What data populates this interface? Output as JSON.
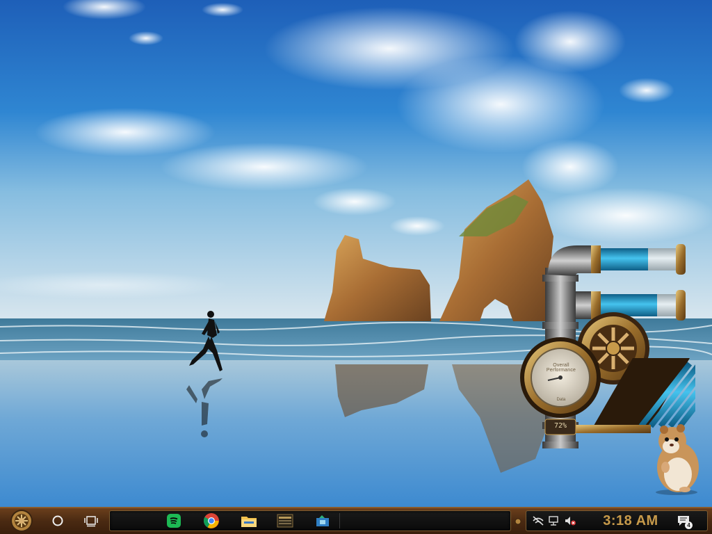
{
  "gauge": {
    "label_top": "Overall Performance",
    "label_bottom": "Data",
    "percent_text": "72%",
    "level": 0.72
  },
  "taskbar": {
    "start_icon": "steampunk-gear-icon",
    "search_icon": "cortana-circle-icon",
    "taskview_icon": "task-view-icon",
    "apps": [
      {
        "name": "spotify",
        "icon": "spotify-icon",
        "color": "#1db954"
      },
      {
        "name": "chrome",
        "icon": "chrome-icon"
      },
      {
        "name": "file-explorer",
        "icon": "folder-icon",
        "color": "#f2c14e"
      },
      {
        "name": "market-app",
        "icon": "market-icon",
        "label": "MARKET"
      },
      {
        "name": "app-window",
        "icon": "app-window-icon",
        "color": "#2fb37a"
      }
    ],
    "tray": {
      "icons": [
        "network-off-icon",
        "monitor-network-icon",
        "volume-muted-icon"
      ],
      "clock": "3:18 AM",
      "notification_count": "4"
    }
  },
  "colors": {
    "taskbar_brown": "#4a2a12",
    "clock_amber": "#c79a4a",
    "gauge_blue": "#2aa8d8"
  }
}
